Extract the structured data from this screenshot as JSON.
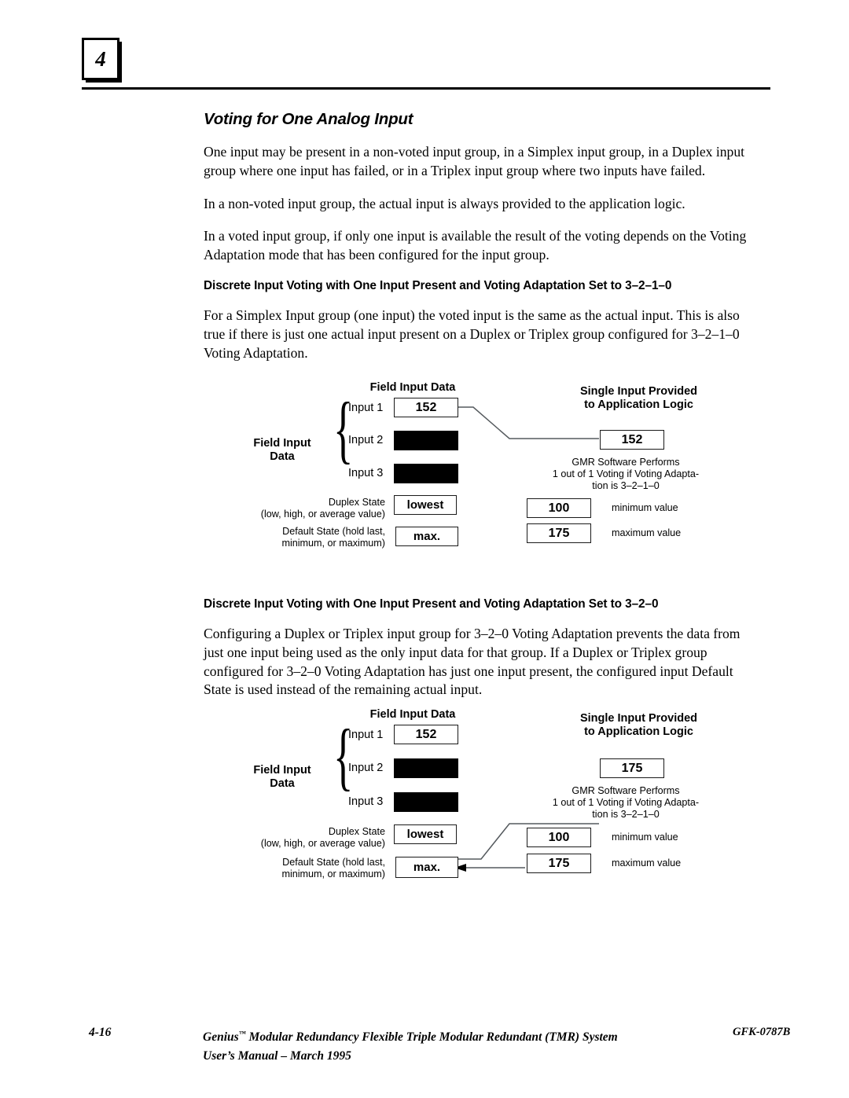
{
  "page": {
    "chapter_number": "4",
    "section_title": "Voting for One Analog Input",
    "paragraphs": [
      "One input may be present in a non-voted input group, in a Simplex input group, in a Duplex input group where one input has failed, or in a Triplex input group where two inputs have failed.",
      "In a non-voted input group, the actual input is always provided to the application logic.",
      "In a voted input group, if only one input is available the result of the voting depends on the Voting Adaptation mode that has been configured for the input group."
    ],
    "sub1_title": "Discrete Input Voting with One Input Present and Voting  Adaptation  Set  to  3–2–1–0",
    "sub1_para": "For a Simplex Input group (one input) the voted input is the same as the actual input. This is also true if there is just one actual input present on a Duplex or Triplex group configured  for  3–2–1–0  Voting Adaptation.",
    "sub2_title": "Discrete Input Voting with One Input Present and Voting  Adaptation  Set  to  3–2–0",
    "sub2_para": "Configuring a Duplex or Triplex  input  group  for 3–2–0 Voting Adaptation prevents the data from just one input being used as the only input data for that group. If a Duplex or Triplex  group  configured  for  3–2–0 Voting Adaptation has just one input present, the configured input Default State is used instead of the remaining actual input."
  },
  "figure1": {
    "field_input_data_title": "Field Input Data",
    "field_input_data_brace_label_line1": "Field Input",
    "field_input_data_brace_label_line2": "Data",
    "input_labels": [
      "Input 1",
      "Input 2",
      "Input 3"
    ],
    "input_values": [
      "152",
      "",
      ""
    ],
    "input_filled": [
      false,
      true,
      true
    ],
    "duplex_state_line1": "Duplex State",
    "duplex_state_line2": "(low, high, or average value)",
    "duplex_state_value": "lowest",
    "default_state_line1": "Default State (hold last,",
    "default_state_line2": "minimum, or maximum)",
    "default_state_value": "max.",
    "output_title_line1": "Single Input Provided",
    "output_title_line2": "to Application Logic",
    "output_value": "152",
    "note_line1": "GMR Software Performs",
    "note_line2": "1 out of 1 Voting if Voting Adapta-",
    "note_line3": "tion is 3–2–1–0",
    "min_value": "100",
    "min_label": "minimum value",
    "max_value": "175",
    "max_label": "maximum value"
  },
  "figure2": {
    "field_input_data_title": "Field Input Data",
    "field_input_data_brace_label_line1": "Field Input",
    "field_input_data_brace_label_line2": "Data",
    "input_labels": [
      "Input 1",
      "Input 2",
      "Input 3"
    ],
    "input_values": [
      "152",
      "",
      ""
    ],
    "input_filled": [
      false,
      true,
      true
    ],
    "duplex_state_line1": "Duplex State",
    "duplex_state_line2": "(low, high, or average value)",
    "duplex_state_value": "lowest",
    "default_state_line1": "Default State (hold last,",
    "default_state_line2": "minimum, or maximum)",
    "default_state_value": "max.",
    "output_title_line1": "Single Input Provided",
    "output_title_line2": "to Application Logic",
    "output_value": "175",
    "note_line1": "GMR Software Performs",
    "note_line2": "1 out of 1 Voting if Voting Adapta-",
    "note_line3": "tion is 3–2–1–0",
    "min_value": "100",
    "min_label": "minimum value",
    "max_value": "175",
    "max_label": "maximum value"
  },
  "footer": {
    "page_number": "4-16",
    "manual_title_line1_a": "Genius",
    "manual_title_line1_tm": "™",
    "manual_title_line1_b": " Modular Redundancy Flexible Triple Modular Redundant (TMR) System",
    "manual_title_line2": "User’s Manual – March 1995",
    "doc_code": "GFK-0787B"
  }
}
